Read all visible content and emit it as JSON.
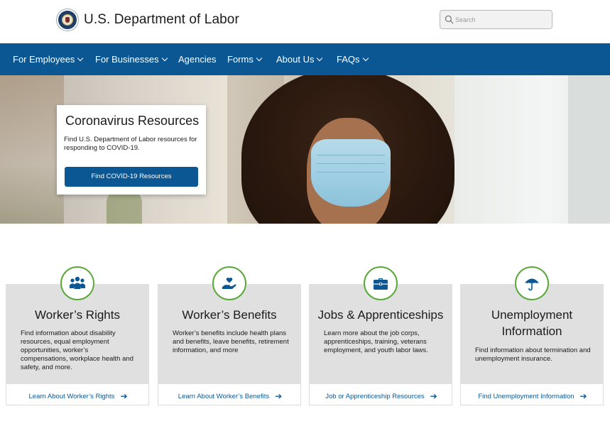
{
  "header": {
    "site_title": "U.S. Department of Labor",
    "search": {
      "placeholder": "Search",
      "value": ""
    }
  },
  "nav": {
    "items": [
      {
        "label": "For Employees",
        "has_dropdown": true
      },
      {
        "label": "For Businesses",
        "has_dropdown": true
      },
      {
        "label": "Agencies",
        "has_dropdown": false
      },
      {
        "label": "Forms",
        "has_dropdown": true
      },
      {
        "label": "About Us",
        "has_dropdown": true
      },
      {
        "label": "FAQs",
        "has_dropdown": true
      }
    ]
  },
  "hero": {
    "title": "Coronavirus Resources",
    "description": "Find U.S. Department of Labor resources for responding to COVID-19.",
    "button_label": "Find COVID-19 Resources"
  },
  "cards": [
    {
      "icon": "group-icon",
      "title": "Worker’s Rights",
      "description": "Find information about disability resources, equal employment opportunities, worker’s compensations, workplace health and safety, and more.",
      "link_label": "Learn About Worker’s Rights"
    },
    {
      "icon": "hand-heart-icon",
      "title": "Worker’s Benefits",
      "description": "Worker’s benefits include health plans and benefits, leave benefits, retirement information, and more",
      "link_label": "Learn About Worker’s Benefits"
    },
    {
      "icon": "briefcase-icon",
      "title": "Jobs & Apprenticeships",
      "description": "Learn more about the job corps, apprenticeships, training, veterans employment, and youth labor laws.",
      "link_label": "Job or Apprenticeship Resources"
    },
    {
      "icon": "umbrella-icon",
      "title": "Unemployment Information",
      "description": "Find information about termination and unemployment insurance.",
      "link_label": "Find Unemployment Information"
    }
  ],
  "colors": {
    "nav_blue": "#0b5794",
    "icon_ring_green": "#5aa83a",
    "card_gray": "#e0e0e0"
  }
}
